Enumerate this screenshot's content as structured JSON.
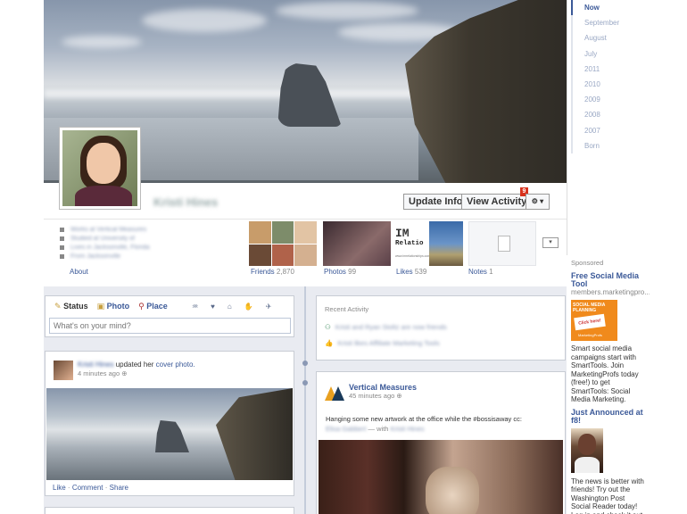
{
  "profile": {
    "name": "Kristi Hines",
    "update_info": "Update Info",
    "view_activity": "View Activity",
    "activity_badge": "9",
    "gear": "⚙ ▾"
  },
  "about": {
    "label": "About",
    "items": [
      "Works at Vertical Measures",
      "Studied at University of",
      "Lives in Jacksonville, Florida",
      "From Jacksonville"
    ]
  },
  "thumbs": {
    "friends_label": "Friends",
    "friends_count": "2,870",
    "photos_label": "Photos",
    "photos_count": "99",
    "likes_label": "Likes",
    "likes_count": "539",
    "notes_label": "Notes",
    "notes_count": "1",
    "likes_badge_text": "IM",
    "likes_badge_sub": "Relatio",
    "likes_url": "www.imrelationships.com"
  },
  "composer": {
    "status": "Status",
    "photo": "Photo",
    "place": "Place",
    "placeholder": "What's on your mind?"
  },
  "post1": {
    "author": "Kristi Hines",
    "action": "updated her",
    "link": "cover photo.",
    "time": "4 minutes ago",
    "like": "Like",
    "comment": "Comment",
    "share": "Share",
    "sep": "·"
  },
  "recent": {
    "title": "Recent Activity",
    "line1": "Kristi and Ryan Stoltz are now friends",
    "line2": "Kristi likes Affiliate Marketing Tools"
  },
  "post2": {
    "author": "Vertical Measures",
    "time": "45 minutes ago",
    "text": "Hanging some new artwork at the office while the #bossisaway cc:",
    "with_pre": "Elisa Gabbert",
    "with": "— with",
    "with_post": "Kristi Hines"
  },
  "timeline": {
    "items": [
      "Now",
      "September",
      "August",
      "July",
      "2011",
      "2010",
      "2009",
      "2008",
      "2007",
      "Born"
    ]
  },
  "sidebar": {
    "sponsored": "Sponsored",
    "ad1_title": "Free Social Media Tool",
    "ad1_url": "members.marketingpro...",
    "ad1_img_text": "SOCIAL MEDIA PLANNING",
    "ad1_img_sub": "Click here!",
    "ad1_img_brand": "MarketingProfs",
    "ad1_body": "Smart social media campaigns start with SmartTools. Join MarketingProfs today (free!) to get SmartTools: Social Media Marketing.",
    "ad2_title": "Just Announced at f8!",
    "ad2_body": "The news is better with friends! Try out the Washington Post Social Reader today! Log in and check it out today!"
  },
  "colors": {
    "link": "#3b5998",
    "bg": "#e9ebf1",
    "ad_orange": "#f08a1c"
  }
}
